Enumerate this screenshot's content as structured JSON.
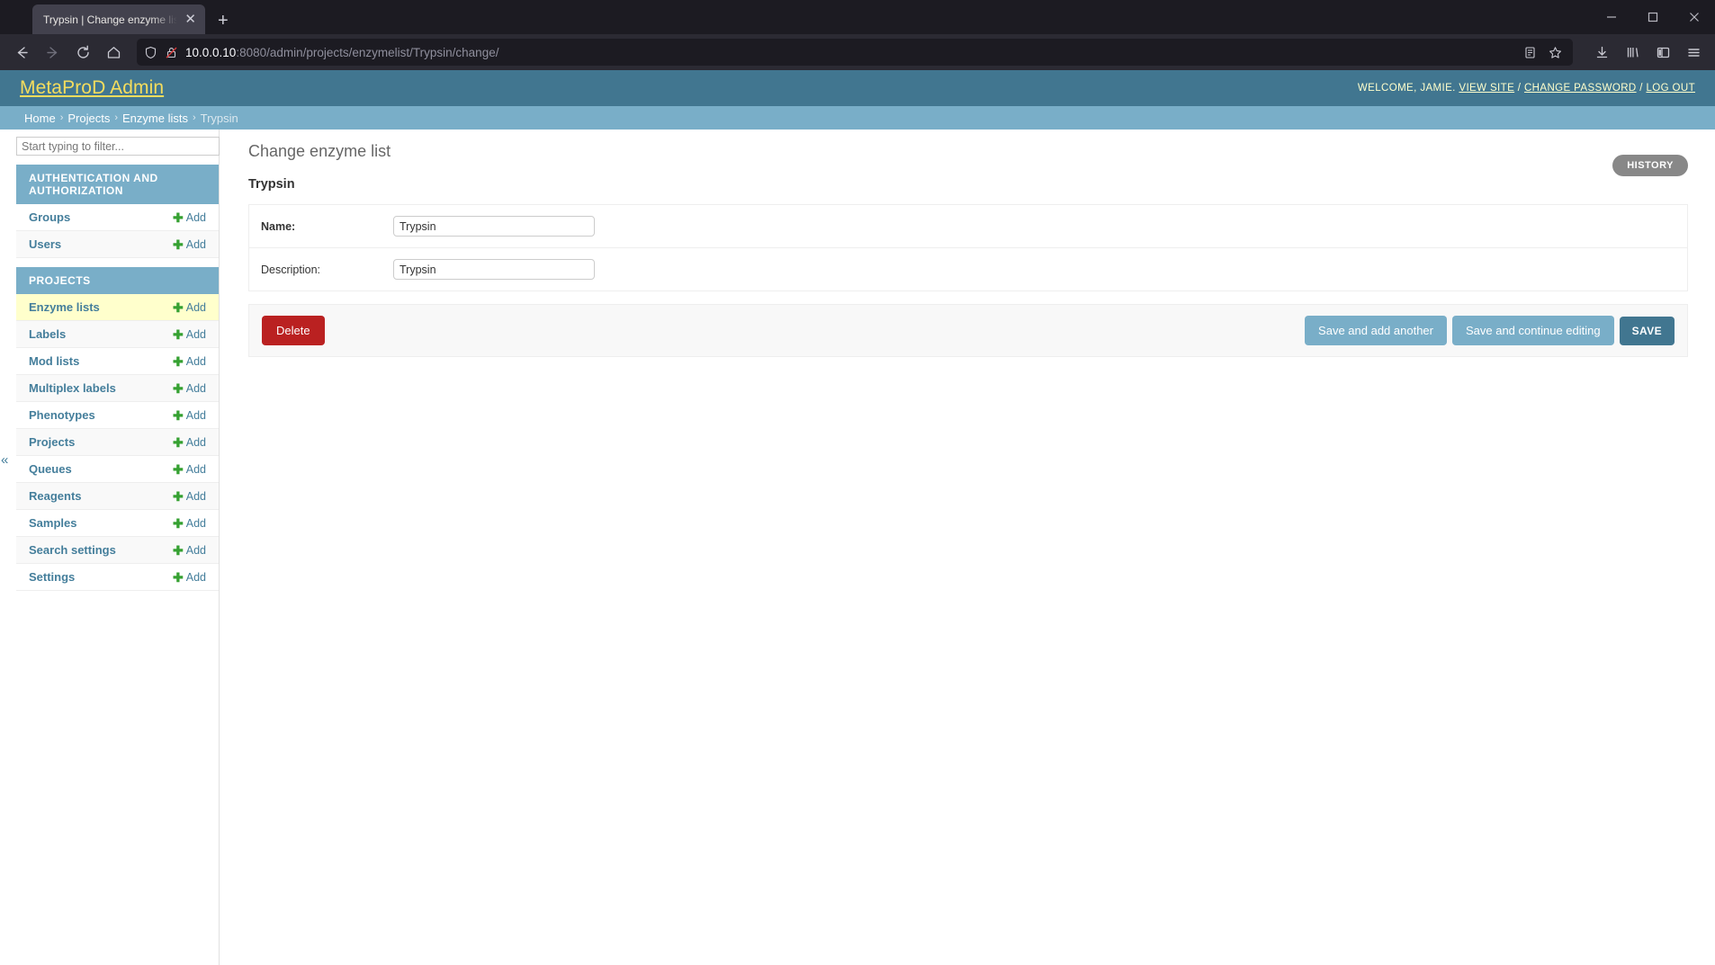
{
  "browser": {
    "tab_title": "Trypsin | Change enzyme list | MetaP",
    "tab_close_icon": "close-icon",
    "new_tab_icon": "plus-icon",
    "back_icon": "back-arrow-icon",
    "forward_icon": "forward-arrow-icon",
    "reload_icon": "reload-icon",
    "home_icon": "home-icon",
    "shield_icon": "shield-icon",
    "lock_broken_icon": "lock-crossed-icon",
    "url_host": "10.0.0.10",
    "url_rest": ":8080/admin/projects/enzymelist/Trypsin/change/",
    "reader_icon": "reader-view-icon",
    "bookmark_icon": "star-icon",
    "downloads_icon": "download-icon",
    "library_icon": "library-icon",
    "sidebar_icon": "sidebar-toggle-icon",
    "menu_icon": "hamburger-menu-icon",
    "minimize_icon": "minimize-icon",
    "maximize_icon": "maximize-icon",
    "close_window_icon": "close-window-icon"
  },
  "header": {
    "brand": "MetaProD Admin",
    "welcome": "WELCOME, JAMIE.",
    "view_site": "VIEW SITE",
    "change_password": "CHANGE PASSWORD",
    "log_out": "LOG OUT",
    "sep": "/"
  },
  "breadcrumbs": {
    "items": [
      {
        "label": "Home",
        "current": false
      },
      {
        "label": "Projects",
        "current": false
      },
      {
        "label": "Enzyme lists",
        "current": false
      },
      {
        "label": "Trypsin",
        "current": true
      }
    ],
    "separator": "›"
  },
  "sidebar": {
    "filter_placeholder": "Start typing to filter...",
    "filter_value": "",
    "collapse_label": "«",
    "apps": [
      {
        "name": "AUTHENTICATION AND AUTHORIZATION",
        "models": [
          {
            "label": "Groups",
            "add": "Add",
            "current": false
          },
          {
            "label": "Users",
            "add": "Add",
            "current": false
          }
        ]
      },
      {
        "name": "PROJECTS",
        "models": [
          {
            "label": "Enzyme lists",
            "add": "Add",
            "current": true
          },
          {
            "label": "Labels",
            "add": "Add",
            "current": false
          },
          {
            "label": "Mod lists",
            "add": "Add",
            "current": false
          },
          {
            "label": "Multiplex labels",
            "add": "Add",
            "current": false
          },
          {
            "label": "Phenotypes",
            "add": "Add",
            "current": false
          },
          {
            "label": "Projects",
            "add": "Add",
            "current": false
          },
          {
            "label": "Queues",
            "add": "Add",
            "current": false
          },
          {
            "label": "Reagents",
            "add": "Add",
            "current": false
          },
          {
            "label": "Samples",
            "add": "Add",
            "current": false
          },
          {
            "label": "Search settings",
            "add": "Add",
            "current": false
          },
          {
            "label": "Settings",
            "add": "Add",
            "current": false
          }
        ]
      }
    ]
  },
  "main": {
    "page_title": "Change enzyme list",
    "history_button": "HISTORY",
    "object_name": "Trypsin",
    "fields": [
      {
        "label": "Name:",
        "value": "Trypsin",
        "required": true
      },
      {
        "label": "Description:",
        "value": "Trypsin",
        "required": false
      }
    ],
    "delete_button": "Delete",
    "save_add_another": "Save and add another",
    "save_continue": "Save and continue editing",
    "save": "SAVE"
  },
  "colors": {
    "brand_bar": "#417690",
    "breadcrumb_bar": "#79aec8",
    "brand_text": "#f5dd5d",
    "delete": "#ba2121",
    "current_row": "#ffffcc",
    "add_plus": "#36a132"
  }
}
